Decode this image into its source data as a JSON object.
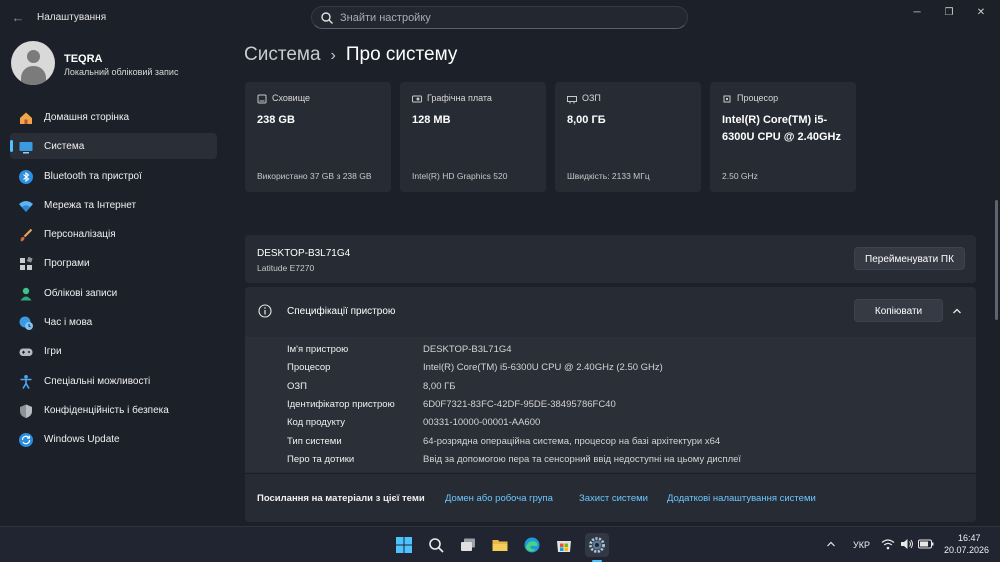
{
  "app": {
    "title": "Налаштування",
    "back_glyph": "←"
  },
  "search": {
    "placeholder": "Знайти настройку",
    "value": ""
  },
  "window_controls": {
    "minimize": "─",
    "maximize": "❐",
    "close": "✕"
  },
  "user": {
    "name": "TEQRA",
    "account_type": "Локальний обліковий запис"
  },
  "sidebar": {
    "items": [
      {
        "label": "Домашня сторінка",
        "icon": "home-icon",
        "active": false
      },
      {
        "label": "Система",
        "icon": "monitor-icon",
        "active": true
      },
      {
        "label": "Bluetooth та пристрої",
        "icon": "bluetooth-icon",
        "active": false
      },
      {
        "label": "Мережа та Інтернет",
        "icon": "wifi-icon",
        "active": false
      },
      {
        "label": "Персоналізація",
        "icon": "brush-icon",
        "active": false
      },
      {
        "label": "Програми",
        "icon": "apps-icon",
        "active": false
      },
      {
        "label": "Облікові записи",
        "icon": "accounts-icon",
        "active": false
      },
      {
        "label": "Час і мова",
        "icon": "time-language-icon",
        "active": false
      },
      {
        "label": "Ігри",
        "icon": "gamepad-icon",
        "active": false
      },
      {
        "label": "Спеціальні можливості",
        "icon": "accessibility-icon",
        "active": false
      },
      {
        "label": "Конфіденційність і безпека",
        "icon": "shield-icon",
        "active": false
      },
      {
        "label": "Windows Update",
        "icon": "update-icon",
        "active": false
      }
    ]
  },
  "breadcrumb": {
    "parent": "Система",
    "separator": "›",
    "current": "Про систему"
  },
  "cards": [
    {
      "title": "Сховище",
      "icon": "storage-icon",
      "value": "238 GB",
      "detail": "Використано 37 GB з 238 GB"
    },
    {
      "title": "Графічна плата",
      "icon": "graphics-card-icon",
      "value": "128 MB",
      "detail": "Intel(R) HD Graphics 520"
    },
    {
      "title": "ОЗП",
      "icon": "ram-icon",
      "value": "8,00 ГБ",
      "detail": "Швидкість: 2133 МГц"
    },
    {
      "title": "Процесор",
      "icon": "cpu-icon",
      "value": "Intel(R) Core(TM) i5-6300U CPU @ 2.40GHz",
      "detail": "2.50 GHz"
    }
  ],
  "device": {
    "name": "DESKTOP-B3L71G4",
    "model": "Latitude E7270",
    "rename_label": "Перейменувати ПК"
  },
  "specs": {
    "title": "Специфікації пристрою",
    "copy_label": "Копіювати",
    "rows": [
      {
        "key": "Ім'я пристрою",
        "value": "DESKTOP-B3L71G4"
      },
      {
        "key": "Процесор",
        "value": "Intel(R) Core(TM) i5-6300U CPU @ 2.40GHz (2.50 GHz)"
      },
      {
        "key": "ОЗП",
        "value": "8,00 ГБ"
      },
      {
        "key": "Ідентифікатор пристрою",
        "value": "6D0F7321-83FC-42DF-95DE-38495786FC40"
      },
      {
        "key": "Код продукту",
        "value": "00331-10000-00001-AA600"
      },
      {
        "key": "Тип системи",
        "value": "64-розрядна операційна система, процесор на базі архітектури x64"
      },
      {
        "key": "Перо та дотики",
        "value": "Ввід за допомогою пера та сенсорний ввід недоступні на цьому дисплеї"
      }
    ],
    "links_label": "Посилання на матеріали з цієї теми",
    "links": [
      "Домен або робоча група",
      "Захист системи",
      "Додаткові налаштування системи"
    ]
  },
  "taskbar": {
    "apps": [
      "windows-start-icon",
      "search-icon",
      "task-view-icon",
      "file-explorer-icon",
      "edge-icon",
      "store-icon",
      "settings-icon"
    ],
    "language": "УКР",
    "time": "16:47",
    "date": "20.07.2026"
  },
  "colors": {
    "accent": "#4cc2ff",
    "link": "#6cc7ff",
    "background": "#1c2029",
    "card": "#272b34"
  }
}
